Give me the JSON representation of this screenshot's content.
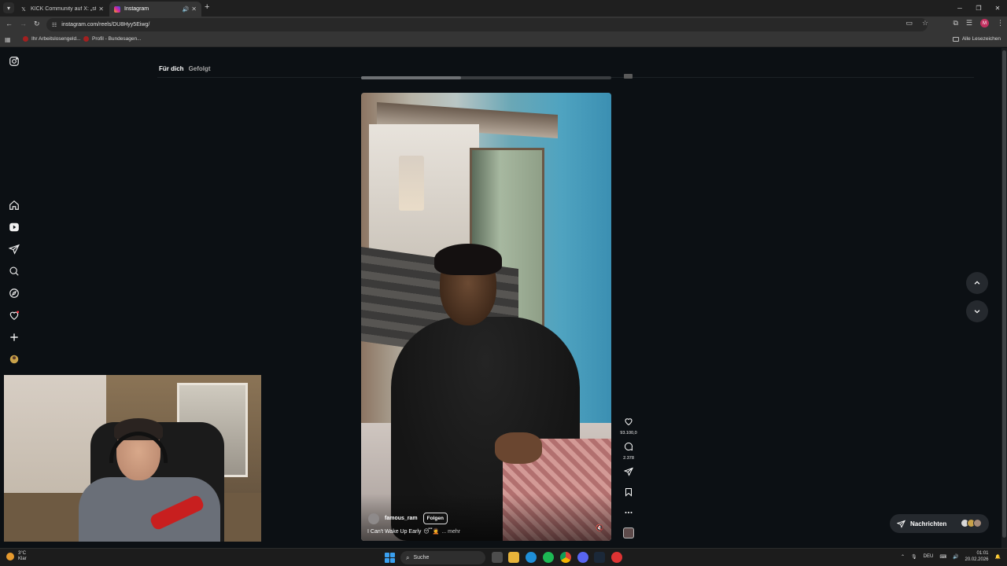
{
  "browser": {
    "tabs": [
      {
        "title": "KICK Community auf X: „stream",
        "active": false
      },
      {
        "title": "Instagram",
        "active": true
      }
    ],
    "url": "instagram.com/reels/DU8Hyy5Eiwg/",
    "bookmarks": [
      "Ihr Arbeitslosengeld...",
      "Profil - Bundesagen..."
    ],
    "all_bookmarks_label": "Alle Lesezeichen",
    "profile_initial": "M"
  },
  "instagram": {
    "feed_tabs": {
      "for_you": "Für dich",
      "following": "Gefolgt"
    },
    "reel_progress": 0.4,
    "reel": {
      "username": "famous_ram",
      "follow_label": "Folgen",
      "caption": "I Can't Wake Up Early",
      "caption_emojis": "😴🤦",
      "more_label": "... mehr"
    },
    "likes": "93.100,0",
    "comments": "2.378",
    "messages_label": "Nachrichten"
  },
  "taskbar": {
    "temperature": "3°C",
    "weather_status": "Klar",
    "search_label": "Suche",
    "language": "DEU",
    "time": "01:01",
    "date": "20.02.2026"
  },
  "colors": {
    "ig_background": "#0c1014",
    "accent_start": "#3aa0f0",
    "profile": "#c2305f"
  }
}
